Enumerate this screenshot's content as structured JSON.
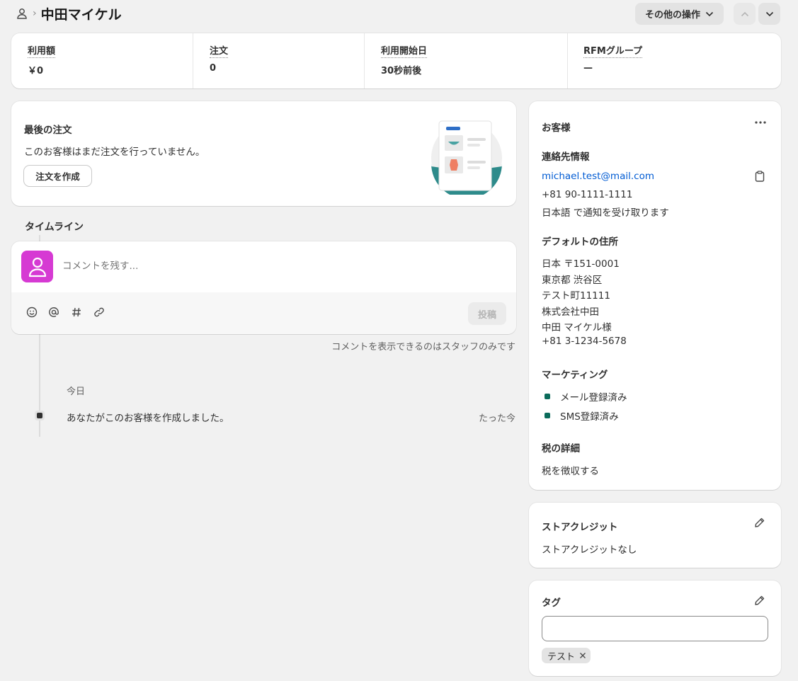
{
  "header": {
    "title": "中田マイケル",
    "more_actions_label": "その他の操作"
  },
  "metrics": [
    {
      "label": "利用額",
      "value": "￥0"
    },
    {
      "label": "注文",
      "value": "0"
    },
    {
      "label": "利用開始日",
      "value": "30秒前後"
    },
    {
      "label": "RFMグループ",
      "value": "—"
    }
  ],
  "last_order": {
    "title": "最後の注文",
    "description": "このお客様はまだ注文を行っていません。",
    "create_order_label": "注文を作成"
  },
  "timeline": {
    "title": "タイムライン",
    "comment_placeholder": "コメントを残す...",
    "post_label": "投稿",
    "staff_note": "コメントを表示できるのはスタッフのみです",
    "date_label": "今日",
    "events": [
      {
        "text": "あなたがこのお客様を作成しました。",
        "time": "たった今"
      }
    ]
  },
  "customer": {
    "title": "お客様",
    "contact_heading": "連絡先情報",
    "email": "michael.test@mail.com",
    "phone": "+81 90-1111-1111",
    "notification_language": "日本語 で通知を受け取ります",
    "address_heading": "デフォルトの住所",
    "address_lines": [
      "日本 〒151-0001",
      "東京都 渋谷区",
      "テスト町11111",
      "株式会社中田",
      "中田 マイケル様",
      "+81 3-1234-5678"
    ],
    "marketing_heading": "マーケティング",
    "marketing_items": [
      "メール登録済み",
      "SMS登録済み"
    ],
    "tax_heading": "税の詳細",
    "tax_value": "税を徴収する"
  },
  "store_credit": {
    "title": "ストアクレジット",
    "value": "ストアクレジットなし"
  },
  "tags": {
    "title": "タグ",
    "input_value": "",
    "items": [
      "テスト"
    ]
  },
  "colors": {
    "accent_link": "#005bd3",
    "avatar": "#d63ad3",
    "marketing_dot": "#0b6b5b",
    "illustration_teal": "#2e8b8b"
  }
}
